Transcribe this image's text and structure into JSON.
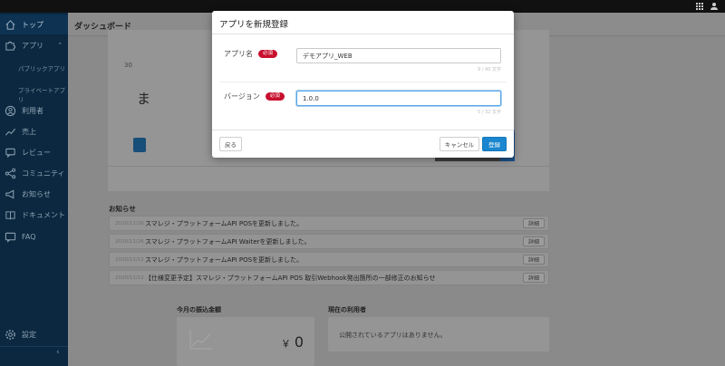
{
  "sidebar": {
    "items": [
      {
        "label": "トップ",
        "icon": "home-icon"
      },
      {
        "label": "アプリ",
        "icon": "puzzle-icon"
      },
      {
        "label": "利用者",
        "icon": "user-circle-icon"
      },
      {
        "label": "売上",
        "icon": "trend-icon"
      },
      {
        "label": "レビュー",
        "icon": "review-icon"
      },
      {
        "label": "コミュニティ",
        "icon": "share-icon"
      },
      {
        "label": "お知らせ",
        "icon": "megaphone-icon"
      },
      {
        "label": "ドキュメント",
        "icon": "book-icon"
      },
      {
        "label": "FAQ",
        "icon": "faq-icon"
      }
    ],
    "app_subitems": [
      "パブリックアプリ",
      "プライベートアプリ"
    ],
    "settings_label": "設定",
    "collapse_glyph": "‹"
  },
  "main": {
    "title": "ダッシュボード",
    "hero_small_text": "30",
    "hero_big_text": "ま",
    "notices_title": "お知らせ",
    "notices": [
      {
        "date": "2020/11/26",
        "text": "スマレジ・プラットフォームAPI POSを更新しました。",
        "button": "詳細"
      },
      {
        "date": "2020/11/26",
        "text": "スマレジ・プラットフォームAPI Waiterを更新しました。",
        "button": "詳細"
      },
      {
        "date": "2020/11/12",
        "text": "スマレジ・プラットフォームAPI POSを更新しました。",
        "button": "詳細"
      },
      {
        "date": "2020/11/12",
        "text": "【仕様変更予定】スマレジ・プラットフォームAPI POS 取引Webhook発出箇所の一部修正のお知らせ",
        "button": "詳細"
      }
    ],
    "monthly_title": "今月の振込金額",
    "monthly_currency": "￥",
    "monthly_amount": "0",
    "users_title": "現在の利用者",
    "users_empty": "公開されているアプリはありません。"
  },
  "modal": {
    "title": "アプリを新規登録",
    "required_badge": "必須",
    "app_name_label": "アプリ名",
    "app_name_value": "デモアプリ_WEB",
    "app_name_counter": "9 / 40 文字",
    "version_label": "バージョン",
    "version_value": "1.0.0",
    "version_counter": "5 / 32 文字",
    "back_button": "戻る",
    "cancel_button": "キャンセル",
    "submit_button": "登録"
  },
  "colors": {
    "primary": "#1a86cf",
    "required": "#c8102e",
    "sidebar": "#0b2840",
    "overlay": "#8a8a8a"
  }
}
